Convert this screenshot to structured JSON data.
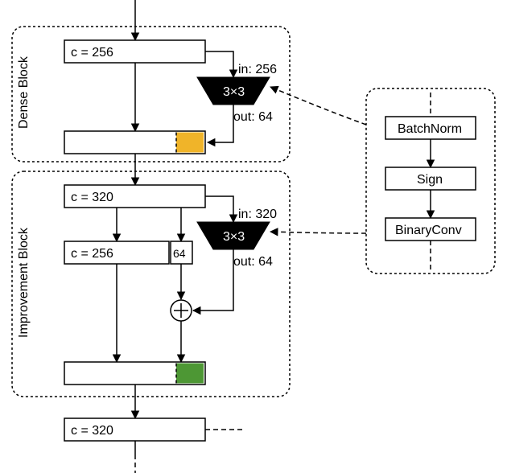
{
  "chart_data": {
    "type": "diagram",
    "blocks": [
      {
        "name": "Dense Block",
        "input_channels": 256,
        "conv": {
          "kernel": "3×3",
          "in_channels": 256,
          "out_channels": 64
        },
        "output_channels_after_concat": 320,
        "new_slice_color": "orange"
      },
      {
        "name": "Improvement Block",
        "input_channels": 320,
        "split": {
          "base": 256,
          "tail": 64
        },
        "conv": {
          "kernel": "3×3",
          "in_channels": 320,
          "out_channels": 64
        },
        "fusion": "elementwise_add(tail, conv_out)",
        "output_channels": 320,
        "refined_slice_color": "green"
      }
    ],
    "conv_detail_sequence": [
      "BatchNorm",
      "Sign",
      "BinaryConv"
    ],
    "final_output_channels": 320
  },
  "denseBlock": {
    "title": "Dense Block",
    "c_in": "c = 256",
    "conv": {
      "kernel": "3×3",
      "in": "in: 256",
      "out": "out: 64"
    }
  },
  "impBlock": {
    "title": "Improvement Block",
    "c_in": "c = 320",
    "split_main": "c = 256",
    "split_tail": "64",
    "conv": {
      "kernel": "3×3",
      "in": "in: 320",
      "out": "out: 64"
    }
  },
  "final": {
    "c": "c = 320"
  },
  "detail": {
    "bn": "BatchNorm",
    "sign": "Sign",
    "bconv": "BinaryConv"
  }
}
